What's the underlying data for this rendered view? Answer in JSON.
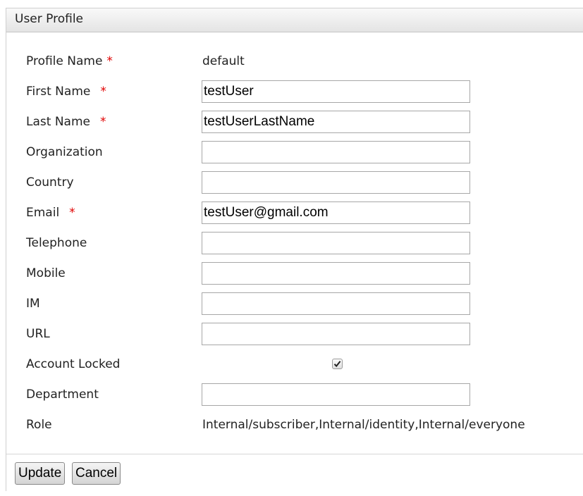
{
  "panel": {
    "title": "User Profile"
  },
  "required_marker": "*",
  "fields": {
    "profile_name": {
      "label": "Profile Name",
      "value": "default"
    },
    "first_name": {
      "label": "First Name",
      "value": "testUser"
    },
    "last_name": {
      "label": "Last Name",
      "value": "testUserLastName"
    },
    "organization": {
      "label": "Organization",
      "value": ""
    },
    "country": {
      "label": "Country",
      "value": ""
    },
    "email": {
      "label": "Email",
      "value": "testUser@gmail.com"
    },
    "telephone": {
      "label": "Telephone",
      "value": ""
    },
    "mobile": {
      "label": "Mobile",
      "value": ""
    },
    "im": {
      "label": "IM",
      "value": ""
    },
    "url": {
      "label": "URL",
      "value": ""
    },
    "account_locked": {
      "label": "Account Locked",
      "checked": true
    },
    "department": {
      "label": "Department",
      "value": ""
    },
    "role": {
      "label": "Role",
      "value": "Internal/subscriber,Internal/identity,Internal/everyone"
    }
  },
  "buttons": {
    "update": "Update",
    "cancel": "Cancel"
  },
  "colors": {
    "required": "#e00000"
  }
}
